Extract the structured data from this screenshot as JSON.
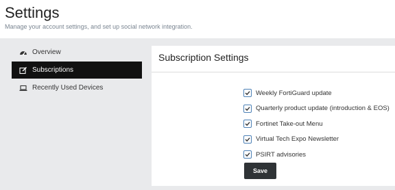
{
  "header": {
    "title": "Settings",
    "subtitle": "Manage your account settings, and set up social network integration."
  },
  "sidebar": {
    "items": [
      {
        "label": "Overview",
        "icon": "dashboard-icon",
        "active": false
      },
      {
        "label": "Subscriptions",
        "icon": "edit-icon",
        "active": true
      },
      {
        "label": "Recently Used Devices",
        "icon": "laptop-icon",
        "active": false
      }
    ]
  },
  "panel": {
    "title": "Subscription Settings",
    "options": [
      {
        "label": "Weekly FortiGuard update",
        "checked": true
      },
      {
        "label": "Quarterly product update (introduction & EOS)",
        "checked": true
      },
      {
        "label": "Fortinet Take-out Menu",
        "checked": true
      },
      {
        "label": "Virtual Tech Expo Newsletter",
        "checked": true
      },
      {
        "label": "PSIRT advisories",
        "checked": true
      }
    ],
    "save_label": "Save"
  },
  "colors": {
    "background": "#e9eaec",
    "active_item": "#111111",
    "checkbox_border": "#4a7fb5",
    "save_button": "#2f3336"
  }
}
